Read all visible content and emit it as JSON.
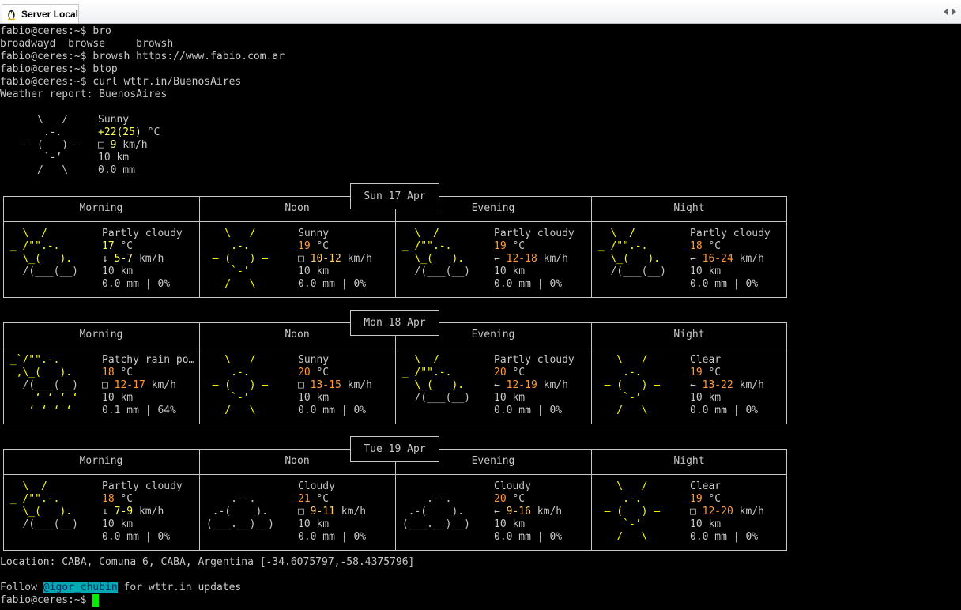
{
  "window": {
    "tab_title": "Server Local",
    "tab_icon": "linux-penguin-icon"
  },
  "colors": {
    "sun": "#ffff00",
    "temp_yellow": "#ffff55",
    "temp_orange": "#ff9a3a",
    "wind_peach": "#ffd070",
    "handle_bg": "#00aab0",
    "cursor": "#00ee00",
    "text": "#c8c8c8"
  },
  "terminal": {
    "lines": {
      "l1": "fabio@ceres:~$ bro",
      "l2": "broadwayd  browse     browsh",
      "l3": "fabio@ceres:~$ browsh https://www.fabio.com.ar",
      "l4": "fabio@ceres:~$ btop",
      "l5": "fabio@ceres:~$ curl wttr.in/BuenosAires",
      "l6": "Weather report: BuenosAires"
    },
    "location": "Location: CABA, Comuna 6, CABA, Argentina [-34.6075797,-58.4375796]",
    "follow_prefix": "Follow ",
    "follow_handle": "@igor_chubin",
    "follow_suffix": " for wttr.in updates",
    "prompt": "fabio@ceres:~$ "
  },
  "current": {
    "condition": "Sunny",
    "temp": "+22(25)",
    "temp_unit": " °C",
    "wind_arrow": "□",
    "wind": "9",
    "wind_unit": " km/h",
    "visibility": "10 km",
    "precip": "0.0 mm"
  },
  "periods": [
    "Morning",
    "Noon",
    "Evening",
    "Night"
  ],
  "days": [
    {
      "date": "Sun 17 Apr",
      "slots": [
        {
          "condition": "Partly cloudy",
          "temp": "17",
          "wind_arrow": "↓",
          "wind": "5-7",
          "visibility": "10 km",
          "precip": "0.0 mm | 0%"
        },
        {
          "condition": "Sunny",
          "temp": "19",
          "wind_arrow": "□",
          "wind": "10-12",
          "visibility": "10 km",
          "precip": "0.0 mm | 0%"
        },
        {
          "condition": "Partly cloudy",
          "temp": "19",
          "wind_arrow": "←",
          "wind": "12-18",
          "visibility": "10 km",
          "precip": "0.0 mm | 0%"
        },
        {
          "condition": "Partly cloudy",
          "temp": "18",
          "wind_arrow": "←",
          "wind": "16-24",
          "visibility": "10 km",
          "precip": "0.0 mm | 0%"
        }
      ]
    },
    {
      "date": "Mon 18 Apr",
      "slots": [
        {
          "condition": "Patchy rain po…",
          "temp": "18",
          "wind_arrow": "□",
          "wind": "12-17",
          "visibility": "10 km",
          "precip": "0.1 mm | 64%"
        },
        {
          "condition": "Sunny",
          "temp": "20",
          "wind_arrow": "□",
          "wind": "13-15",
          "visibility": "10 km",
          "precip": "0.0 mm | 0%"
        },
        {
          "condition": "Partly cloudy",
          "temp": "20",
          "wind_arrow": "←",
          "wind": "12-19",
          "visibility": "10 km",
          "precip": "0.0 mm | 0%"
        },
        {
          "condition": "Clear",
          "temp": "19",
          "wind_arrow": "←",
          "wind": "13-22",
          "visibility": "10 km",
          "precip": "0.0 mm | 0%"
        }
      ]
    },
    {
      "date": "Tue 19 Apr",
      "slots": [
        {
          "condition": "Partly cloudy",
          "temp": "18",
          "wind_arrow": "↓",
          "wind": "7-9",
          "visibility": "10 km",
          "precip": "0.0 mm | 0%"
        },
        {
          "condition": "Cloudy",
          "temp": "21",
          "wind_arrow": "□",
          "wind": "9-11",
          "visibility": "10 km",
          "precip": "0.0 mm | 0%"
        },
        {
          "condition": "Cloudy",
          "temp": "20",
          "wind_arrow": "←",
          "wind": "9-16",
          "visibility": "10 km",
          "precip": "0.0 mm | 0%"
        },
        {
          "condition": "Clear",
          "temp": "19",
          "wind_arrow": "□",
          "wind": "12-20",
          "visibility": "10 km",
          "precip": "0.0 mm | 0%"
        }
      ]
    }
  ]
}
